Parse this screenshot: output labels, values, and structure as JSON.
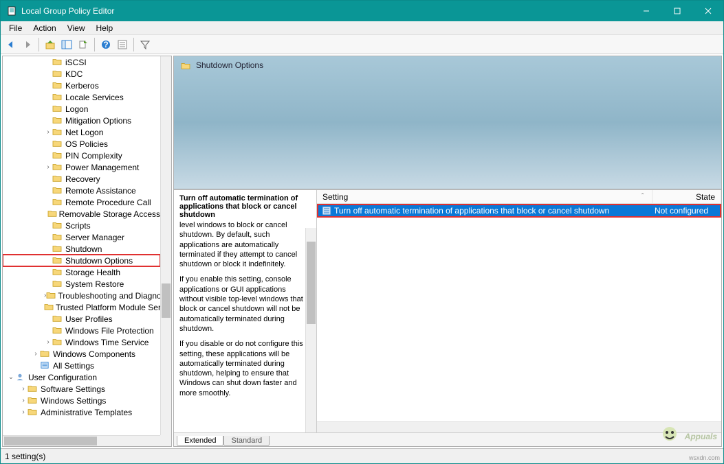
{
  "window": {
    "title": "Local Group Policy Editor"
  },
  "menu": {
    "file": "File",
    "action": "Action",
    "view": "View",
    "help": "Help"
  },
  "tree": {
    "items": [
      {
        "label": "iSCSI",
        "indent": 3
      },
      {
        "label": "KDC",
        "indent": 3
      },
      {
        "label": "Kerberos",
        "indent": 3
      },
      {
        "label": "Locale Services",
        "indent": 3
      },
      {
        "label": "Logon",
        "indent": 3
      },
      {
        "label": "Mitigation Options",
        "indent": 3
      },
      {
        "label": "Net Logon",
        "indent": 3,
        "exp": ">"
      },
      {
        "label": "OS Policies",
        "indent": 3
      },
      {
        "label": "PIN Complexity",
        "indent": 3
      },
      {
        "label": "Power Management",
        "indent": 3,
        "exp": ">"
      },
      {
        "label": "Recovery",
        "indent": 3
      },
      {
        "label": "Remote Assistance",
        "indent": 3
      },
      {
        "label": "Remote Procedure Call",
        "indent": 3
      },
      {
        "label": "Removable Storage Access",
        "indent": 3
      },
      {
        "label": "Scripts",
        "indent": 3
      },
      {
        "label": "Server Manager",
        "indent": 3
      },
      {
        "label": "Shutdown",
        "indent": 3
      },
      {
        "label": "Shutdown Options",
        "indent": 3,
        "hl": true
      },
      {
        "label": "Storage Health",
        "indent": 3
      },
      {
        "label": "System Restore",
        "indent": 3
      },
      {
        "label": "Troubleshooting and Diagnostics",
        "indent": 3,
        "exp": ">"
      },
      {
        "label": "Trusted Platform Module Services",
        "indent": 3
      },
      {
        "label": "User Profiles",
        "indent": 3
      },
      {
        "label": "Windows File Protection",
        "indent": 3
      },
      {
        "label": "Windows Time Service",
        "indent": 3,
        "exp": ">"
      },
      {
        "label": "Windows Components",
        "indent": 2,
        "exp": ">"
      },
      {
        "label": "All Settings",
        "indent": 2,
        "icon": "settings"
      },
      {
        "label": "User Configuration",
        "indent": 0,
        "exp": "v",
        "icon": "user"
      },
      {
        "label": "Software Settings",
        "indent": 1,
        "exp": ">"
      },
      {
        "label": "Windows Settings",
        "indent": 1,
        "exp": ">"
      },
      {
        "label": "Administrative Templates",
        "indent": 1,
        "exp": ">"
      }
    ]
  },
  "header": {
    "title": "Shutdown Options"
  },
  "description": {
    "title": "Turn off automatic termination of applications that block or cancel shutdown",
    "p1": "level windows to block or cancel shutdown. By default, such applications are automatically terminated if they attempt to cancel shutdown or block it indefinitely.",
    "p2": "If you enable this setting, console applications or GUI applications without visible top-level windows that block or cancel shutdown will not be automatically terminated during shutdown.",
    "p3": "If you disable or do not configure this setting, these applications will be automatically terminated during shutdown, helping to ensure that Windows can shut down faster and more smoothly."
  },
  "columns": {
    "setting": "Setting",
    "state": "State"
  },
  "setting_row": {
    "name": "Turn off automatic termination of applications that block or cancel shutdown",
    "state": "Not configured"
  },
  "tabs": {
    "extended": "Extended",
    "standard": "Standard"
  },
  "status": {
    "text": "1 setting(s)"
  },
  "watermark": {
    "text": "Appuals",
    "sub": "wsxdn.com"
  }
}
